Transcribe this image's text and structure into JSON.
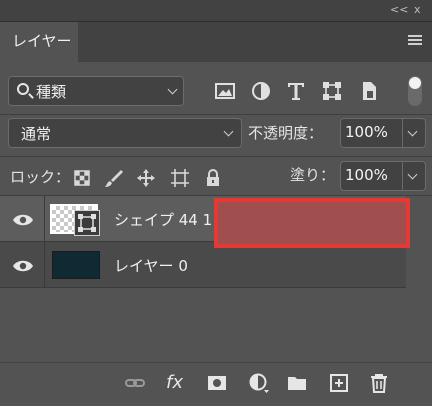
{
  "panel": {
    "collapse_glyph": "<<",
    "close_glyph": "x",
    "tab_label": "レイヤー",
    "menu_icon": "hamburger-icon"
  },
  "filter": {
    "kind_label": "種類",
    "icons": [
      "image-filter-icon",
      "adjustment-filter-icon",
      "type-filter-icon",
      "shape-filter-icon",
      "smart-object-filter-icon"
    ],
    "toggle_icon": "filter-toggle"
  },
  "blend": {
    "mode": "通常",
    "opacity_label": "不透明度：",
    "opacity_value": "100%",
    "lock_label": "ロック：",
    "fill_label": "塗り：",
    "fill_value": "100%",
    "lock_icons": [
      "lock-transparent-icon",
      "lock-brush-icon",
      "lock-move-icon",
      "lock-artboard-icon",
      "lock-all-icon"
    ]
  },
  "layers": [
    {
      "name": "シェイプ 44 1",
      "visible": true,
      "type": "shape",
      "selected": true
    },
    {
      "name": "レイヤー 0",
      "visible": true,
      "type": "pixel",
      "selected": false
    }
  ],
  "highlight_color": "#e53935",
  "bottom": {
    "fx_label": "fx",
    "icons": [
      "link-icon",
      "fx-icon",
      "mask-icon",
      "adjustment-icon",
      "folder-icon",
      "new-layer-icon",
      "trash-icon"
    ]
  }
}
